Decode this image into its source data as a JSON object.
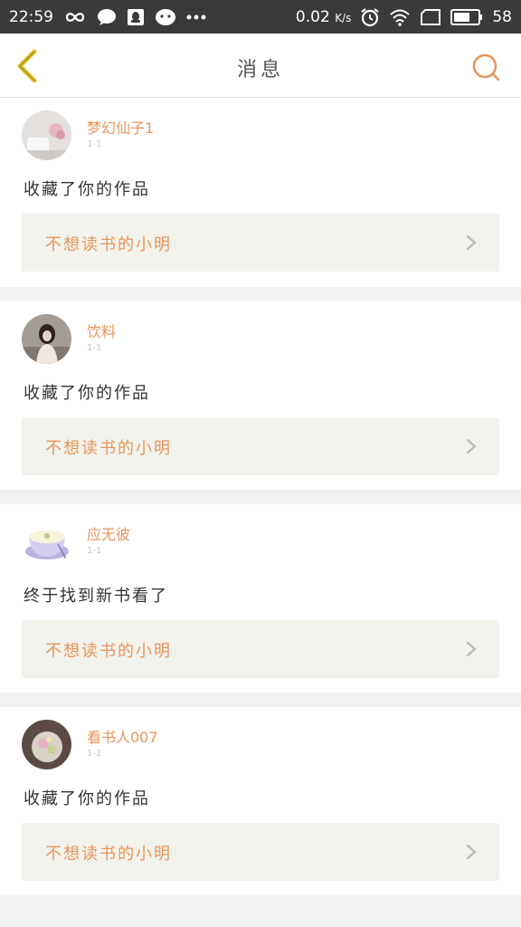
{
  "status_bar": {
    "time": "22:59",
    "speed": "0.02",
    "speed_unit": "K/s",
    "battery": "58",
    "left_icons": [
      "infinity-icon",
      "chat-bubble-icon",
      "qq-icon",
      "wechat-icon",
      "more-dots-icon"
    ],
    "right_icons": [
      "alarm-icon",
      "wifi-icon",
      "sim-icon",
      "battery-icon"
    ]
  },
  "header": {
    "title": "消息",
    "back_icon": "back-chevron-icon",
    "search_icon": "search-icon"
  },
  "colors": {
    "accent": "#e8955a",
    "back_arrow": "#e6c224",
    "status_bar_bg": "#3a3a3a",
    "card_bg": "#ffffff",
    "work_box_bg": "#f2f2ec"
  },
  "notifications": [
    {
      "user": "梦幻仙子1",
      "time": "1-1",
      "message": "收藏了你的作品",
      "work": "不想读书的小明"
    },
    {
      "user": "饮料",
      "time": "1-1",
      "message": "收藏了你的作品",
      "work": "不想读书的小明"
    },
    {
      "user": "应无彼",
      "time": "1-1",
      "message": "终于找到新书看了",
      "work": "不想读书的小明"
    },
    {
      "user": "看书人007",
      "time": "1-1",
      "message": "收藏了你的作品",
      "work": "不想读书的小明"
    }
  ]
}
